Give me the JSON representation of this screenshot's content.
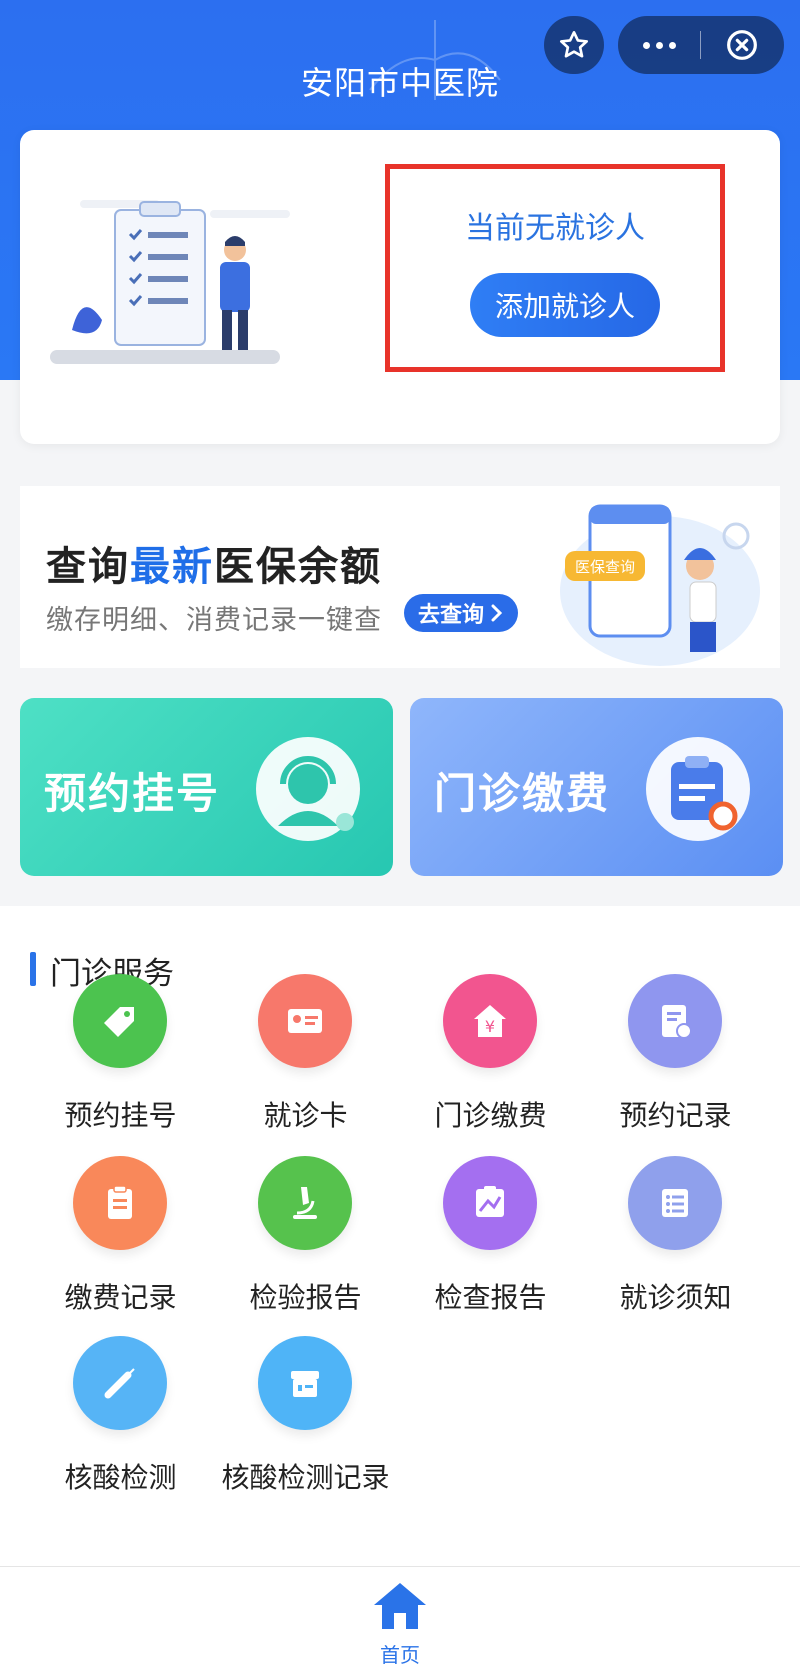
{
  "header": {
    "title": "安阳市中医院",
    "favorite_icon": "star-icon",
    "more_icon": "more-dots-icon",
    "close_icon": "close-circle-icon"
  },
  "patient_card": {
    "status_text": "当前无就诊人",
    "add_button_label": "添加就诊人"
  },
  "promo": {
    "title_prefix": "查询",
    "title_highlight": "最新",
    "title_suffix": "医保余额",
    "subtitle": "缴存明细、消费记录一键查",
    "button_label": "去查询",
    "badge_text": "医保查询"
  },
  "big_tiles": [
    {
      "label": "预约挂号",
      "icon": "doctor-headset-icon"
    },
    {
      "label": "门诊缴费",
      "icon": "clipboard-bill-icon"
    }
  ],
  "services": {
    "section_title": "门诊服务",
    "items": [
      {
        "label": "预约挂号",
        "icon": "tag-icon",
        "color": "#4cc34f"
      },
      {
        "label": "就诊卡",
        "icon": "id-card-icon",
        "color": "#f7786b"
      },
      {
        "label": "门诊缴费",
        "icon": "yuan-house-icon",
        "color": "#f2558f"
      },
      {
        "label": "预约记录",
        "icon": "document-clock-icon",
        "color": "#8f96ef"
      },
      {
        "label": "缴费记录",
        "icon": "clipboard-icon",
        "color": "#f9885a"
      },
      {
        "label": "检验报告",
        "icon": "microscope-icon",
        "color": "#56c24d"
      },
      {
        "label": "检查报告",
        "icon": "xray-report-icon",
        "color": "#a46ff0"
      },
      {
        "label": "就诊须知",
        "icon": "list-icon",
        "color": "#8fa0ec"
      },
      {
        "label": "核酸检测",
        "icon": "syringe-icon",
        "color": "#56b4f6"
      },
      {
        "label": "核酸检测记录",
        "icon": "box-record-icon",
        "color": "#4fb4f7"
      }
    ]
  },
  "tabbar": {
    "home_label": "首页",
    "home_icon": "home-icon",
    "accent": "#2a73e8"
  }
}
